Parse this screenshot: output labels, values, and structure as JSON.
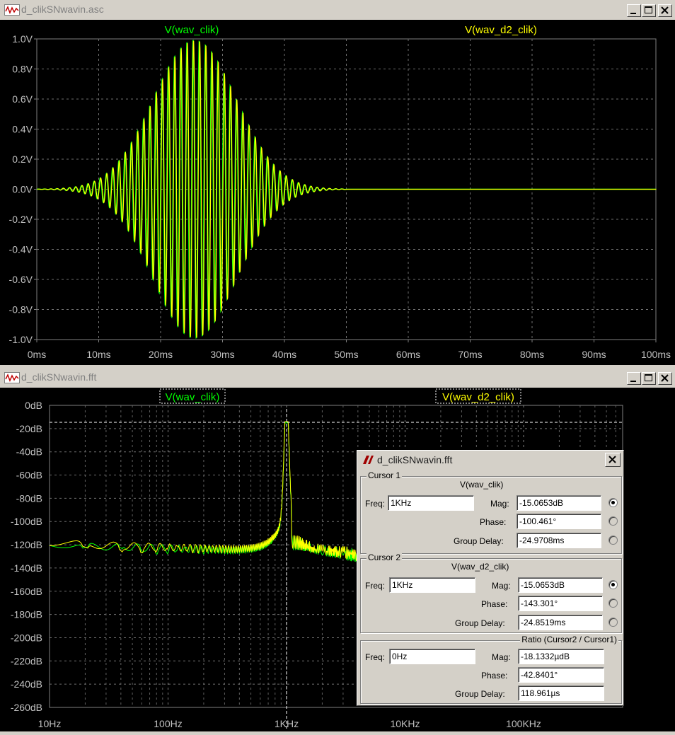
{
  "top_window": {
    "title": "d_clikSNwavin.asc",
    "trace1": "V(wav_clik)",
    "trace2": "V(wav_d2_clik)",
    "y_ticks": [
      "1.0V",
      "0.8V",
      "0.6V",
      "0.4V",
      "0.2V",
      "0.0V",
      "-0.2V",
      "-0.4V",
      "-0.6V",
      "-0.8V",
      "-1.0V"
    ],
    "x_ticks": [
      "0ms",
      "10ms",
      "20ms",
      "30ms",
      "40ms",
      "50ms",
      "60ms",
      "70ms",
      "80ms",
      "90ms",
      "100ms"
    ]
  },
  "bottom_window": {
    "title": "d_clikSNwavin.fft",
    "trace1": "V(wav_clik)",
    "trace2": "V(wav_d2_clik)",
    "y_ticks": [
      "0dB",
      "-20dB",
      "-40dB",
      "-60dB",
      "-80dB",
      "-100dB",
      "-120dB",
      "-140dB",
      "-160dB",
      "-180dB",
      "-200dB",
      "-220dB",
      "-240dB",
      "-260dB"
    ],
    "x_ticks": [
      "10Hz",
      "100Hz",
      "1KHz",
      "10KHz",
      "100KHz"
    ]
  },
  "cursor_dialog": {
    "title": "d_clikSNwavin.fft",
    "cursor1": {
      "group_label": "Cursor 1",
      "trace": "V(wav_clik)",
      "freq_label": "Freq:",
      "freq": "1KHz",
      "mag_label": "Mag:",
      "mag": "-15.0653dB",
      "phase_label": "Phase:",
      "phase": "-100.461°",
      "gd_label": "Group Delay:",
      "gd": "-24.9708ms"
    },
    "cursor2": {
      "group_label": "Cursor 2",
      "trace": "V(wav_d2_clik)",
      "freq_label": "Freq:",
      "freq": "1KHz",
      "mag_label": "Mag:",
      "mag": "-15.0653dB",
      "phase_label": "Phase:",
      "phase": "-143.301°",
      "gd_label": "Group Delay:",
      "gd": "-24.8519ms"
    },
    "ratio": {
      "group_label": "Ratio (Cursor2 / Cursor1)",
      "freq_label": "Freq:",
      "freq": "0Hz",
      "mag_label": "Mag:",
      "mag": "-18.1332µdB",
      "phase_label": "Phase:",
      "phase": "-42.8401°",
      "gd_label": "Group Delay:",
      "gd": "118.961µs"
    }
  },
  "colors": {
    "trace1": "#00ff00",
    "trace2": "#ffff00",
    "grid": "#808080",
    "plot_bg": "#000000"
  }
}
